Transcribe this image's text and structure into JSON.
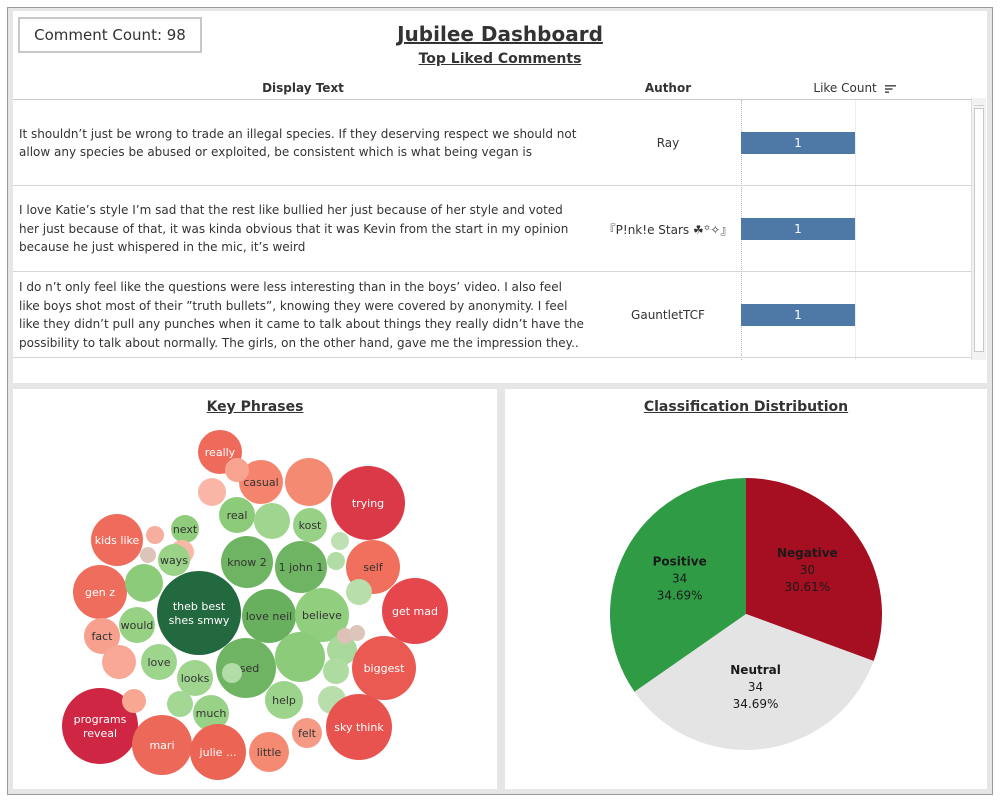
{
  "summary": {
    "comment_count_label": "Comment Count: 98"
  },
  "header": {
    "title": "Jubilee Dashboard",
    "subtitle": "Top Liked Comments"
  },
  "table": {
    "columns": {
      "display_text": "Display Text",
      "author": "Author",
      "like_count": "Like Count"
    },
    "rows": [
      {
        "lines": [
          "It shouldn’t just be wrong to trade an illegal species. If they deserving respect we should not",
          "allow any species be abused or exploited, be consistent which is what being vegan is"
        ],
        "author": "Ray",
        "likes": "1"
      },
      {
        "lines": [
          "I love Katie’s style I’m sad that the rest like bullied her just because of her style and voted",
          "her just because of that, it was kinda obvious that it was Kevin from the start in my opinion",
          "because he just whispered in the mic, it’s weird"
        ],
        "author": "『P!nk!e Stars ☘︎꙳✧』",
        "likes": "1"
      },
      {
        "lines": [
          "I do n’t only feel like the questions were less interesting than in the boys’ video. I also feel",
          "like boys shot most of their ”truth bullets”, knowing they were covered by anonymity. I feel",
          "like they didn’t pull any punches when it came to talk about things they really didn’t have the",
          "possibility to talk about normally. The girls, on the other hand, gave me the impression they.."
        ],
        "author": "GauntletTCF",
        "likes": "1"
      }
    ]
  },
  "key_phrases": {
    "title": "Key Phrases",
    "bubbles": [
      {
        "label": "really",
        "color": "#ee6a5a"
      },
      {
        "label": "casual",
        "color": "#f5846e"
      },
      {
        "label": "",
        "color": "#f58a73"
      },
      {
        "label": "trying",
        "color": "#db3848"
      },
      {
        "label": "",
        "color": "#f7a390"
      },
      {
        "label": "",
        "color": "#f9b6a6"
      },
      {
        "label": "real",
        "color": "#8ccb79"
      },
      {
        "label": "",
        "color": "#9fd58f"
      },
      {
        "label": "kost",
        "color": "#97d186"
      },
      {
        "label": "kids like",
        "color": "#ef6b5b"
      },
      {
        "label": "",
        "color": "#f7ae9e"
      },
      {
        "label": "next",
        "color": "#8fcc7c"
      },
      {
        "label": "know 2",
        "color": "#6fb463"
      },
      {
        "label": "1 john 1",
        "color": "#6fb463"
      },
      {
        "label": "",
        "color": "#bfe0b3"
      },
      {
        "label": "",
        "color": "#b1dca3"
      },
      {
        "label": "self",
        "color": "#f0705d"
      },
      {
        "label": "",
        "color": "#f9b8a7"
      },
      {
        "label": "ways",
        "color": "#9ad388"
      },
      {
        "label": "",
        "color": "#dcc4b8"
      },
      {
        "label": "gen z",
        "color": "#ef6d5c"
      },
      {
        "label": "",
        "color": "#8ccb79"
      },
      {
        "label": "theb best shes smwy",
        "color": "#23693f"
      },
      {
        "label": "love neil",
        "color": "#68b05e"
      },
      {
        "label": "believe",
        "color": "#91cf7f"
      },
      {
        "label": "",
        "color": "#b7deab"
      },
      {
        "label": "get mad",
        "color": "#e5474c"
      },
      {
        "label": "would",
        "color": "#96d184"
      },
      {
        "label": "fact",
        "color": "#f7a08d"
      },
      {
        "label": "",
        "color": "#a8d99b"
      },
      {
        "label": "",
        "color": "#dcc2b6"
      },
      {
        "label": "",
        "color": "#dcc6bb"
      },
      {
        "label": "",
        "color": "#f8a895"
      },
      {
        "label": "love",
        "color": "#9ed58d"
      },
      {
        "label": "used",
        "color": "#6fb463"
      },
      {
        "label": "",
        "color": "#8ccb79"
      },
      {
        "label": "",
        "color": "#aedb9f"
      },
      {
        "label": "biggest",
        "color": "#ea5a52"
      },
      {
        "label": "looks",
        "color": "#9fd58f"
      },
      {
        "label": "",
        "color": "#b3dda6"
      },
      {
        "label": "help",
        "color": "#9bd48a"
      },
      {
        "label": "",
        "color": "#b7deab"
      },
      {
        "label": "programs reveal",
        "color": "#cf2643"
      },
      {
        "label": "much",
        "color": "#98d286"
      },
      {
        "label": "",
        "color": "#a2d794"
      },
      {
        "label": "",
        "color": "#f8a892"
      },
      {
        "label": "felt",
        "color": "#f59a85"
      },
      {
        "label": "sky think",
        "color": "#e8534f"
      },
      {
        "label": "mari",
        "color": "#ec6858"
      },
      {
        "label": "julie ...",
        "color": "#ec6454"
      },
      {
        "label": "little",
        "color": "#f58a73"
      }
    ]
  },
  "classification": {
    "title": "Classification Distribution",
    "chart_data": {
      "type": "pie",
      "title": "Classification Distribution",
      "slices": [
        {
          "name": "Negative",
          "count": "30",
          "percent": "30.61%",
          "value": 30,
          "color": "#a50f21"
        },
        {
          "name": "Neutral",
          "count": "34",
          "percent": "34.69%",
          "value": 34,
          "color": "#e4e4e4"
        },
        {
          "name": "Positive",
          "count": "34",
          "percent": "34.69%",
          "value": 34,
          "color": "#2f9c45"
        }
      ]
    }
  }
}
